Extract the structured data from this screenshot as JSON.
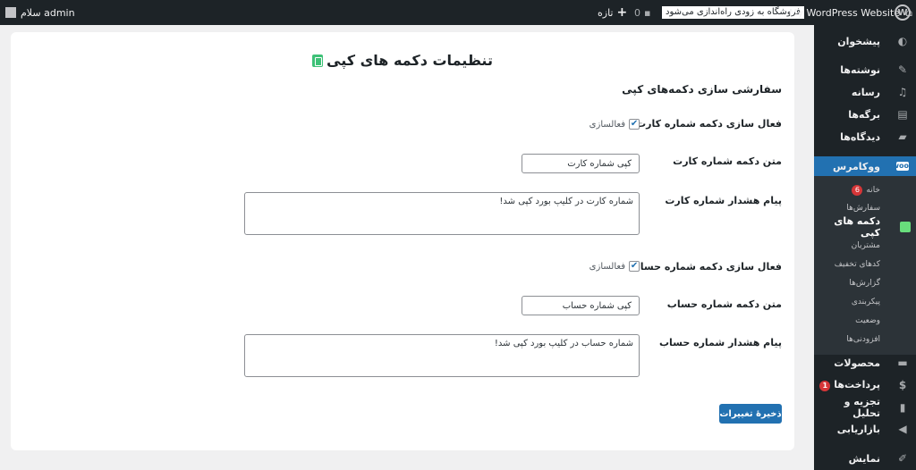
{
  "adminbar": {
    "greeting": "سلام admin",
    "new_label": "تازه",
    "comments_count": "0",
    "notice": "فروشگاه به زودی راه‌اندازی می‌شود",
    "site_name": "My WordPress Website"
  },
  "sidebar": {
    "items": [
      {
        "label": "پیشخوان",
        "icon": "dashboard-icon"
      },
      {
        "label": "نوشته‌ها",
        "icon": "pin-icon"
      },
      {
        "label": "رسانه",
        "icon": "media-icon"
      },
      {
        "label": "برگه‌ها",
        "icon": "pages-icon"
      },
      {
        "label": "دیدگاه‌ها",
        "icon": "comment-icon"
      },
      {
        "label": "ووکامرس",
        "icon": "woo-icon"
      },
      {
        "label": "محصولات",
        "icon": "archive-icon"
      },
      {
        "label": "پرداخت‌ها",
        "icon": "dollar-icon",
        "badge": "1"
      },
      {
        "label": "تجزیه و تحلیل",
        "icon": "chart-icon"
      },
      {
        "label": "بازاریابی",
        "icon": "megaphone-icon"
      },
      {
        "label": "نمایش",
        "icon": "brush-icon"
      }
    ],
    "submenu": [
      {
        "label": "خانه",
        "badge": "6"
      },
      {
        "label": "سفارش‌ها"
      },
      {
        "label": "دکمه های کپی"
      },
      {
        "label": "مشتریان"
      },
      {
        "label": "کدهای تخفیف"
      },
      {
        "label": "گزارش‌ها"
      },
      {
        "label": "پیکربندی"
      },
      {
        "label": "وضعیت"
      },
      {
        "label": "افزودنی‌ها"
      }
    ]
  },
  "page": {
    "title": "تنظیمات دکمه های کپی",
    "section_title": "سفارشی سازی دکمه‌های کپی",
    "card_enable_label": "فعال سازی دکمه شماره کارت",
    "card_enable_text": "فعالسازی",
    "card_button_label": "متن دکمه شماره کارت",
    "card_button_value": "کپی شماره کارت",
    "card_alert_label": "پیام هشدار شماره کارت",
    "card_alert_value": "شماره کارت در کلیپ بورد کپی شد!",
    "account_enable_label": "فعال سازی دکمه شماره حساب",
    "account_enable_text": "فعالسازی",
    "account_button_label": "متن دکمه شماره حساب",
    "account_button_value": "کپی شماره حساب",
    "account_alert_label": "پیام هشدار شماره حساب",
    "account_alert_value": "شماره حساب در کلیپ بورد کپی شد!",
    "save_label": "ذخیرهٔ تغییرات"
  },
  "colors": {
    "accent": "#2271b1",
    "sidebar_bg": "#1d2327",
    "badge": "#d63638",
    "plugin_icon": "#3ec177"
  }
}
